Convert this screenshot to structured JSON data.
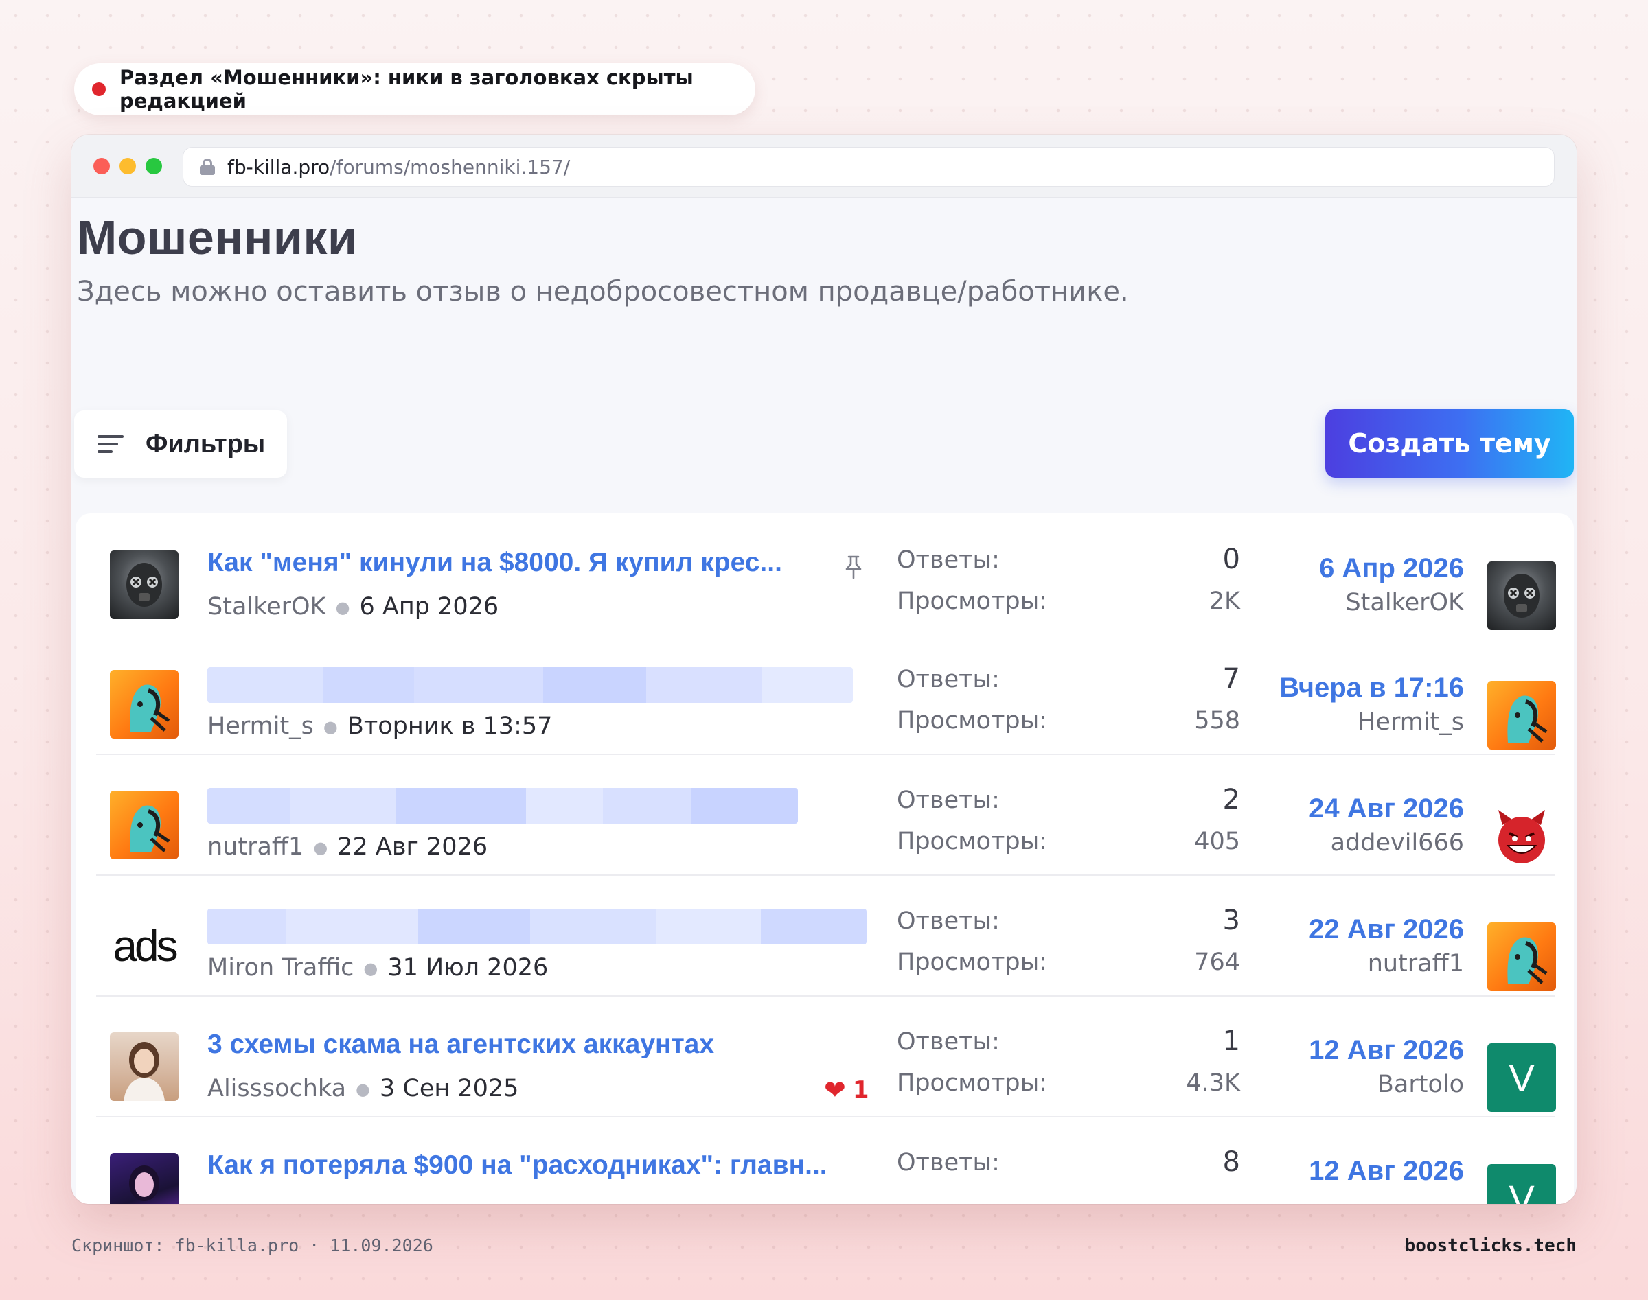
{
  "notice": {
    "text": "Раздел «Мошенники»: ники в заголовках скрыты редакцией",
    "dot_color": "#e0262d"
  },
  "browser": {
    "url_host": "fb-killa.pro",
    "url_path": "/forums/moshenniki.157/"
  },
  "page": {
    "title": "Мошенники",
    "description": "Здесь можно оставить отзыв о недобросовестном продавце/работнике.",
    "filters_label": "Фильтры",
    "create_label": "Создать тему",
    "accent_color": "#3f76e2"
  },
  "labels": {
    "replies": "Ответы:",
    "views": "Просмотры:"
  },
  "threads": [
    {
      "title": "Как \"меня\" кинули на $8000. Я купил крес...",
      "title_hidden": false,
      "pinned": true,
      "author": "StalkerOK",
      "date": "6 Апр 2026",
      "likes": null,
      "replies": "0",
      "views": "2K",
      "last_date": "6 Апр 2026",
      "last_user": "StalkerOK",
      "avatar_icon": "gasmask-avatar-icon",
      "last_avatar_icon": "gasmask-avatar-icon"
    },
    {
      "title": "",
      "title_hidden": true,
      "pinned": false,
      "author": "Hermit_s",
      "date": "Вторник в 13:57",
      "likes": null,
      "replies": "7",
      "views": "558",
      "last_date": "Вчера в 17:16",
      "last_user": "Hermit_s",
      "avatar_icon": "robot-head-avatar-icon",
      "last_avatar_icon": "robot-head-avatar-icon"
    },
    {
      "title": "",
      "title_hidden": true,
      "pinned": false,
      "author": "nutraff1",
      "date": "22 Авг 2026",
      "likes": null,
      "replies": "2",
      "views": "405",
      "last_date": "24 Авг 2026",
      "last_user": "addevil666",
      "avatar_icon": "robot-head-avatar-icon",
      "last_avatar_icon": "devil-face-icon"
    },
    {
      "title": "",
      "title_hidden": true,
      "pinned": false,
      "author": "Miron Traffic",
      "date": "31 Июл 2026",
      "likes": null,
      "replies": "3",
      "views": "764",
      "last_date": "22 Авг 2026",
      "last_user": "nutraff1",
      "avatar_icon": "ads-logo",
      "avatar_text": "ads",
      "last_avatar_icon": "robot-head-avatar-icon"
    },
    {
      "title": "3 схемы скама на агентских аккаунтах",
      "title_hidden": false,
      "pinned": false,
      "author": "Alisssochka",
      "date": "3 Сен 2025",
      "likes": "1",
      "replies": "1",
      "views": "4.3K",
      "last_date": "12 Авг 2026",
      "last_user": "Bartolo",
      "avatar_icon": "photo-avatar-icon",
      "last_avatar_icon": "letter-avatar",
      "last_avatar_letter": "V"
    },
    {
      "title": "Как я потеряла $900 на \"расходниках\": главн...",
      "title_hidden": false,
      "pinned": false,
      "author": "",
      "date": "",
      "likes": null,
      "replies": "8",
      "views": "",
      "last_date": "12 Авг 2026",
      "last_user": "",
      "avatar_icon": "photo-avatar-icon",
      "last_avatar_icon": "letter-avatar",
      "last_avatar_letter": "V"
    }
  ],
  "footer": {
    "left": "Скриншот: fb-killa.pro · 11.09.2026",
    "right": "boostclicks.tech"
  }
}
